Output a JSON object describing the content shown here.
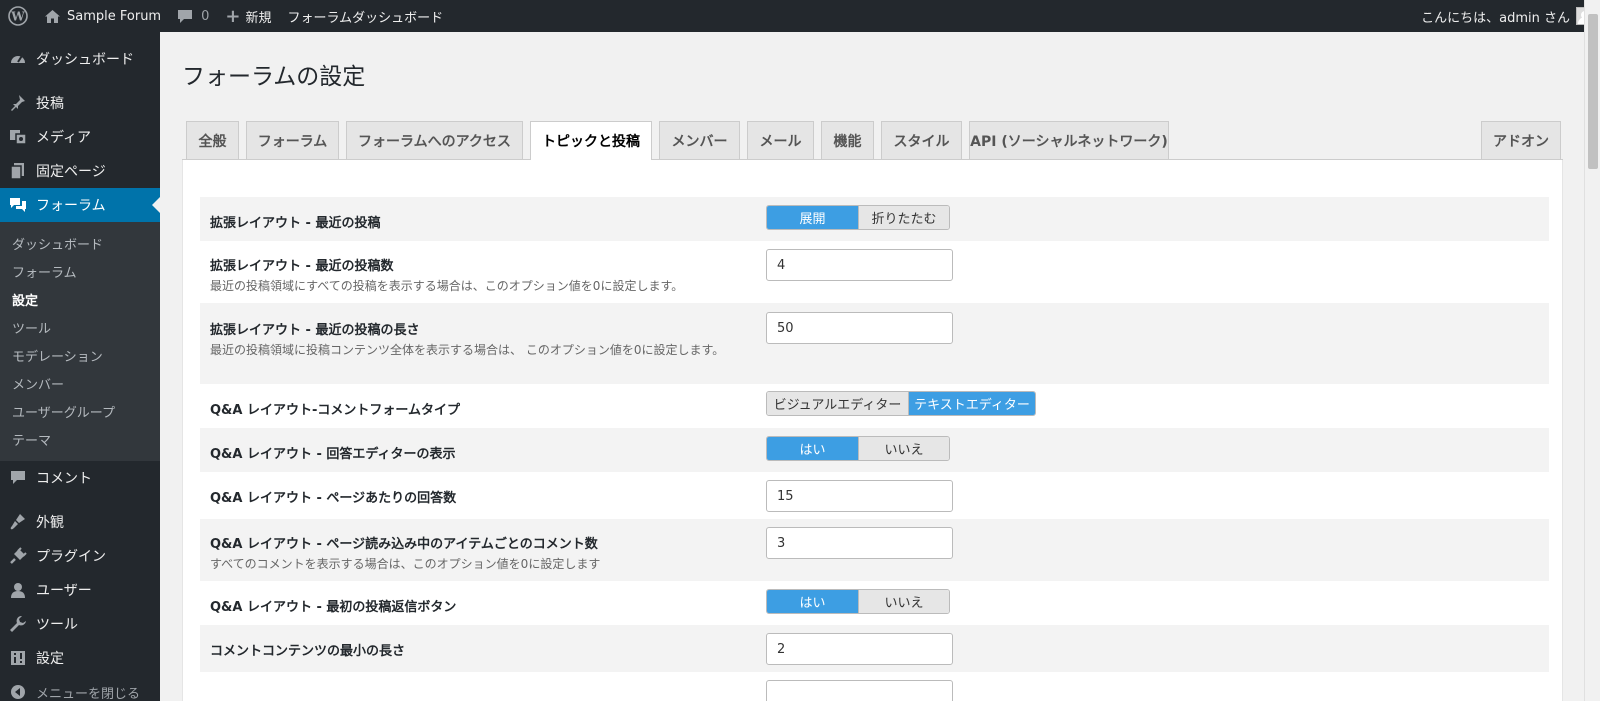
{
  "adminbar": {
    "site_name": "Sample Forum",
    "comments_count": "0",
    "new_label": "新規",
    "forum_dashboard": "フォーラムダッシュボード",
    "greeting": "こんにちは、admin さん"
  },
  "sidebar": {
    "items_top": [
      {
        "label": "ダッシュボード",
        "icon": "dashboard-icon"
      },
      {
        "label": "投稿",
        "icon": "pin-icon"
      },
      {
        "label": "メディア",
        "icon": "media-icon"
      },
      {
        "label": "固定ページ",
        "icon": "pages-icon"
      },
      {
        "label": "フォーラム",
        "icon": "forum-icon"
      }
    ],
    "submenu": [
      "ダッシュボード",
      "フォーラム",
      "設定",
      "ツール",
      "モデレーション",
      "メンバー",
      "ユーザーグループ",
      "テーマ"
    ],
    "items_bottom": [
      {
        "label": "コメント",
        "icon": "comment-icon"
      },
      {
        "label": "外観",
        "icon": "appearance-icon"
      },
      {
        "label": "プラグイン",
        "icon": "plugin-icon"
      },
      {
        "label": "ユーザー",
        "icon": "users-icon"
      },
      {
        "label": "ツール",
        "icon": "tools-icon"
      },
      {
        "label": "設定",
        "icon": "settings-icon"
      },
      {
        "label": "メニューを閉じる",
        "icon": "collapse-icon"
      }
    ]
  },
  "page": {
    "title": "フォーラムの設定"
  },
  "tabs": [
    "全般",
    "フォーラム",
    "フォーラムへのアクセス",
    "トピックと投稿",
    "メンバー",
    "メール",
    "機能",
    "スタイル",
    "API (ソーシャルネットワーク)",
    "アドオン"
  ],
  "active_tab": "トピックと投稿",
  "settings": [
    {
      "label": "拡張レイアウト - 最近の投稿",
      "type": "toggle",
      "options": [
        "展開",
        "折りたたむ"
      ],
      "selected": "展開"
    },
    {
      "label": "拡張レイアウト - 最近の投稿数",
      "desc": "最近の投稿領域にすべての投稿を表示する場合は、このオプション値を0に設定します。",
      "type": "text",
      "value": "4"
    },
    {
      "label": "拡張レイアウト - 最近の投稿の長さ",
      "desc": "最近の投稿領域に投稿コンテンツ全体を表示する場合は、 このオプション値を0に設定します。",
      "type": "text",
      "value": "50"
    },
    {
      "label": "Q&A レイアウト-コメントフォームタイプ",
      "type": "toggle",
      "options": [
        "ビジュアルエディター",
        "テキストエディター"
      ],
      "selected": "テキストエディター"
    },
    {
      "label": "Q&A レイアウト - 回答エディターの表示",
      "type": "toggle",
      "options": [
        "はい",
        "いいえ"
      ],
      "selected": "はい"
    },
    {
      "label": "Q&A レイアウト - ページあたりの回答数",
      "type": "text",
      "value": "15"
    },
    {
      "label": "Q&A レイアウト - ページ読み込み中のアイテムごとのコメント数",
      "desc": "すべてのコメントを表示する場合は、このオプション値を0に設定します",
      "type": "text",
      "value": "3"
    },
    {
      "label": "Q&A レイアウト - 最初の投稿返信ボタン",
      "type": "toggle",
      "options": [
        "はい",
        "いいえ"
      ],
      "selected": "はい"
    },
    {
      "label": "コメントコンテンツの最小の長さ",
      "type": "text",
      "value": "2"
    }
  ],
  "colors": {
    "adminbar_bg": "#23282d",
    "sidebar_active": "#0073aa",
    "toggle_on": "#3d9ee3"
  }
}
